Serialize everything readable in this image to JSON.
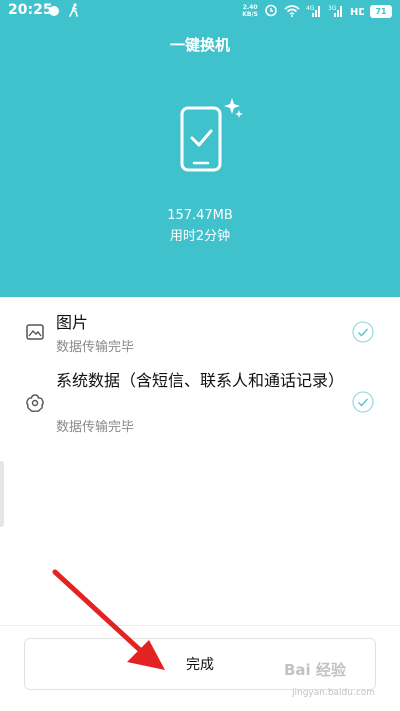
{
  "status_bar": {
    "time": "20:25",
    "net_speed_value": "2.40",
    "net_speed_unit": "KB/S",
    "battery": "71",
    "icons": [
      "chat-bubble-icon",
      "walk-icon",
      "alarm-icon",
      "wifi-icon",
      "signal-4g-icon",
      "signal-3g-icon",
      "hd-icon",
      "battery-icon"
    ]
  },
  "header": {
    "title": "一键换机",
    "size": "157.47MB",
    "duration": "用时2分钟",
    "icons": [
      "phone-check-icon",
      "sparkle-icon"
    ]
  },
  "items": [
    {
      "name": "图片",
      "status": "数据传输完毕",
      "icon": "image-icon",
      "check_icon": "check-circle-icon"
    },
    {
      "name": "系统数据（含短信、联系人和通话记录）",
      "status": "数据传输完毕",
      "icon": "settings-flower-icon",
      "check_icon": "check-circle-icon"
    }
  ],
  "footer": {
    "done_label": "完成"
  },
  "overlay": {
    "watermark": "Bai 经验",
    "watermark_url": "jingyan.baidu.com"
  },
  "colors": {
    "header_bg": "#40c2cd",
    "check_color": "#5fc6d0",
    "arrow": "#e32222"
  }
}
